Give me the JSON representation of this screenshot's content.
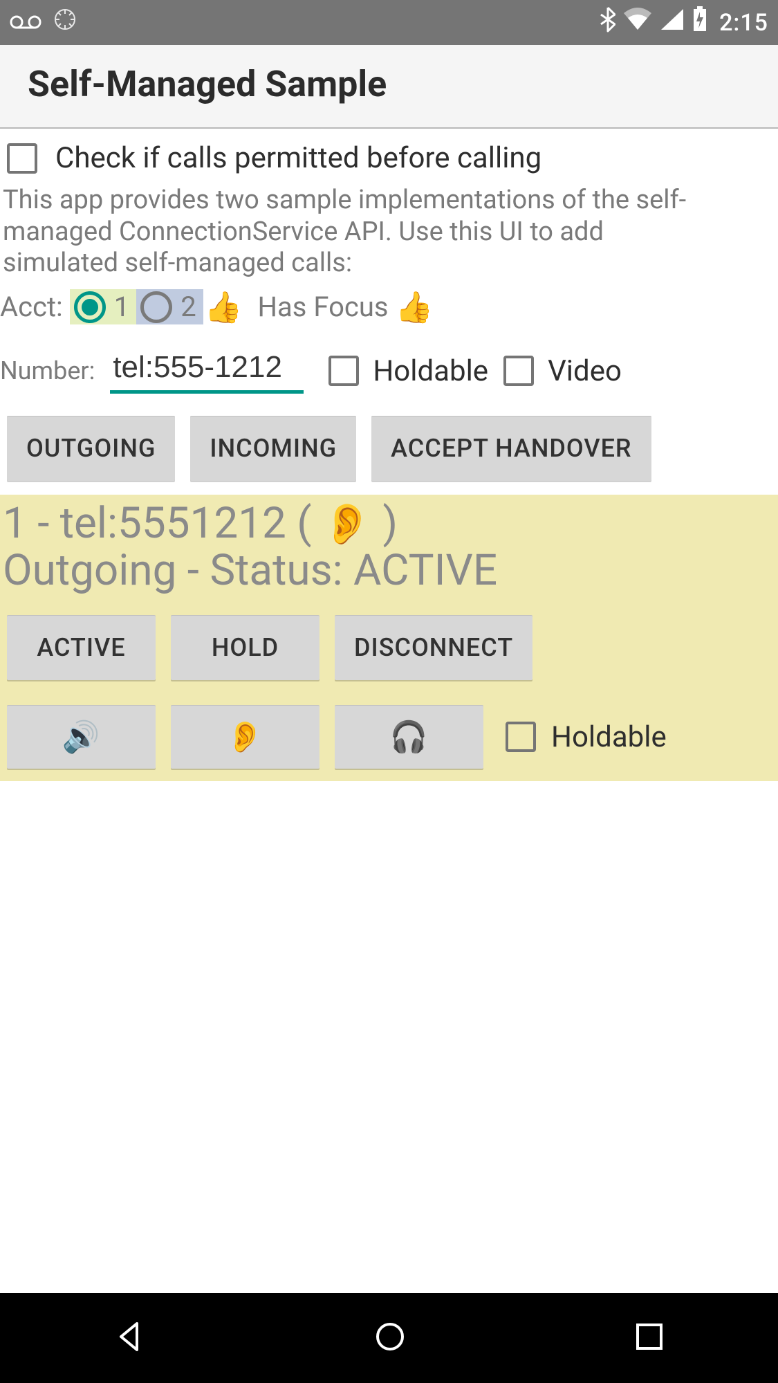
{
  "statusbar": {
    "time": "2:15"
  },
  "actionbar": {
    "title": "Self-Managed Sample"
  },
  "permitted_checkbox": {
    "label": "Check if calls permitted before calling",
    "checked": false
  },
  "description": "This app provides two sample implementations of the self-managed ConnectionService API.  Use this UI to add simulated self-managed calls:",
  "account": {
    "label": "Acct:",
    "opt1_label": "1",
    "opt2_label": "2",
    "selected": "1",
    "focus_text": "Has Focus",
    "thumbs": "👍"
  },
  "number": {
    "label": "Number:",
    "value": "tel:555-1212"
  },
  "holdable_checkbox": {
    "label": "Holdable",
    "checked": false
  },
  "video_checkbox": {
    "label": "Video",
    "checked": false
  },
  "buttons": {
    "outgoing": "OUTGOING",
    "incoming": "INCOMING",
    "accept_handover": "ACCEPT HANDOVER"
  },
  "call": {
    "header_prefix": "1 - tel:5551212 ( ",
    "header_suffix": " )",
    "header_icon": "👂",
    "status_line": "Outgoing - Status: ACTIVE",
    "btn_active": "ACTIVE",
    "btn_hold": "HOLD",
    "btn_disconnect": "DISCONNECT",
    "speaker_icon": "🔊",
    "ear_icon": "👂",
    "headphones_icon": "🎧",
    "holdable_label": "Holdable",
    "holdable_checked": false
  }
}
